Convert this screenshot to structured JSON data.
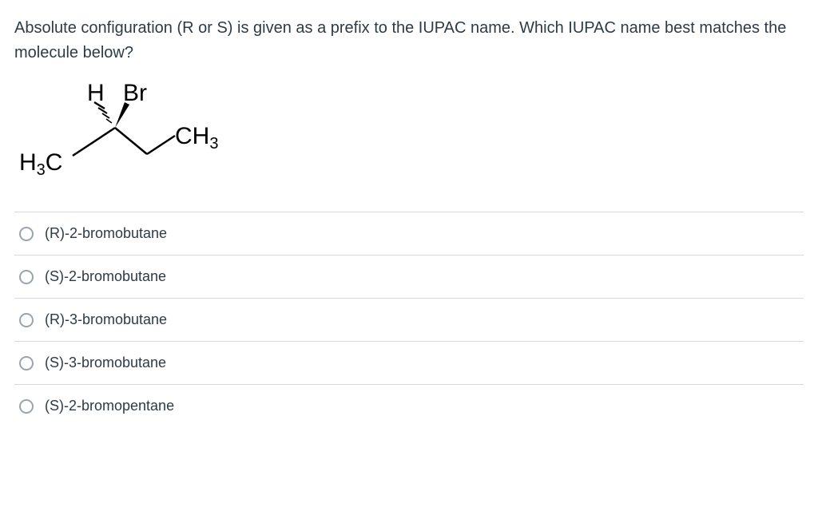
{
  "question_text": "Absolute configuration (R or S) is given as a prefix to the IUPAC name. Which IUPAC name best matches the molecule below?",
  "molecule": {
    "labels": {
      "top_left": "H",
      "top_right": "Br",
      "right": "CH",
      "right_sub": "3",
      "left": "H",
      "left_sub": "3",
      "left_after": "C"
    }
  },
  "options": [
    {
      "label": "(R)-2-bromobutane"
    },
    {
      "label": "(S)-2-bromobutane"
    },
    {
      "label": "(R)-3-bromobutane"
    },
    {
      "label": "(S)-3-bromobutane"
    },
    {
      "label": "(S)-2-bromopentane"
    }
  ]
}
